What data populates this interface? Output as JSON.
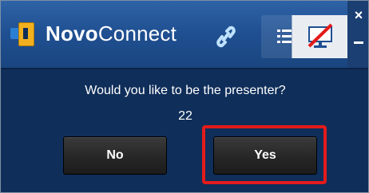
{
  "app": {
    "brand_prefix": "Novo",
    "brand_suffix": "Connect"
  },
  "toolbar": {
    "icons": [
      "logo-icon",
      "link-icon",
      "list-icon",
      "screen-disabled-icon"
    ]
  },
  "window_controls": {
    "close_label": "×",
    "minimize_icon": "minimize-icon"
  },
  "dialog": {
    "question": "Would you like to be the presenter?",
    "countdown": "22",
    "no_label": "No",
    "yes_label": "Yes"
  },
  "colors": {
    "highlight": "#e31b1b",
    "panel": "#0f2e5a",
    "button": "#2a2a2a"
  }
}
